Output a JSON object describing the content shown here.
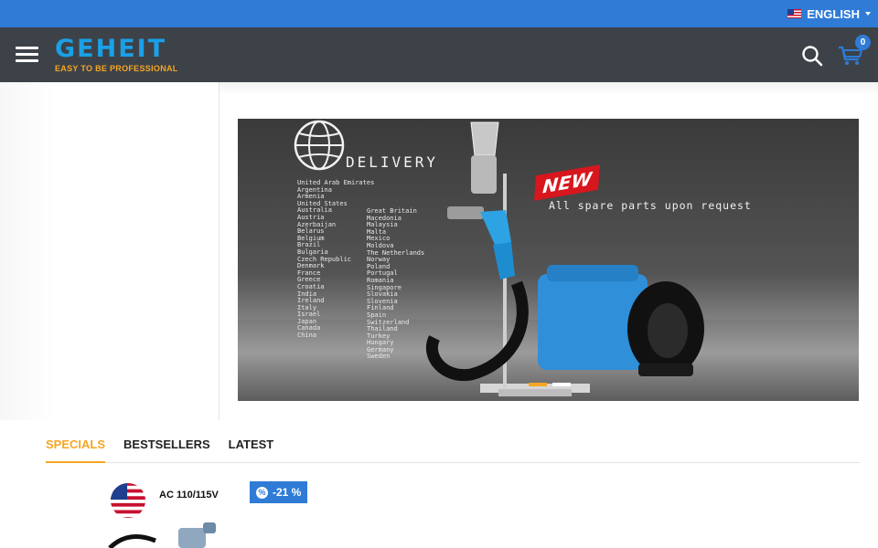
{
  "topbar": {
    "language": "ENGLISH",
    "flag_icon": "uk-flag-icon"
  },
  "header": {
    "logo": {
      "word": "GEHEIT",
      "tagline": "EASY TO BE PROFESSIONAL"
    },
    "cart_count": "0",
    "icons": [
      "menu-icon",
      "search-icon",
      "cart-icon"
    ]
  },
  "slider": {
    "heading": "DELIVERY",
    "countries_col1": [
      "United Arab Emirates",
      "Argentina",
      "Armenia",
      "United States",
      "Australia",
      "Austria",
      "Azerbaijan",
      "Belarus",
      "Belgium",
      "Brazil",
      "Bulgaria",
      "Czech Republic",
      "Denmark",
      "France",
      "Greece",
      "Croatia",
      "India",
      "Ireland",
      "Italy",
      "Israel",
      "Japan",
      "Canada",
      "China"
    ],
    "countries_col2": [
      "Great Britain",
      "Macedonia",
      "Malaysia",
      "Malta",
      "Mexico",
      "Moldova",
      "The Netherlands",
      "Norway",
      "Poland",
      "Portugal",
      "Romania",
      "Singapore",
      "Slovakia",
      "Slovenia",
      "Finland",
      "Spain",
      "Switzerland",
      "Thailand",
      "Turkey",
      "Hungary",
      "Germany",
      "Sweden"
    ],
    "badge": "NEW",
    "tagline": "All spare parts upon request",
    "slide_count": 2,
    "active_slide": 1
  },
  "tabs": [
    {
      "label": "SPECIALS",
      "active": true
    },
    {
      "label": "BESTSELLERS",
      "active": false
    },
    {
      "label": "LATEST",
      "active": false
    }
  ],
  "product": {
    "image_label": "AC 110/115V",
    "discount": "-21 %"
  },
  "colors": {
    "primary": "#2f7bd6",
    "accent": "#f5a623",
    "header": "#3d4248"
  }
}
